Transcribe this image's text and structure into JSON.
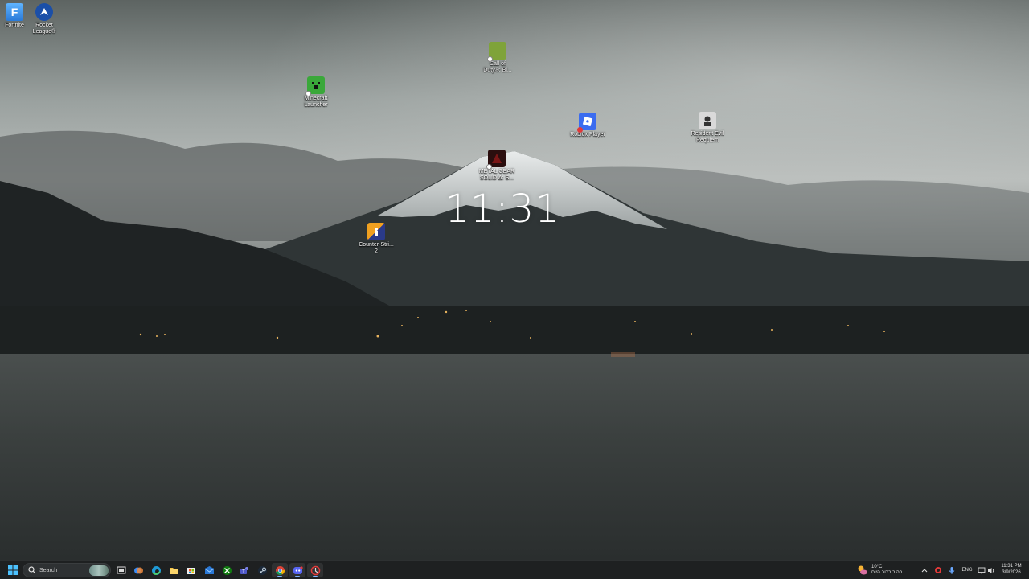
{
  "desktop": {
    "clock": "11:31",
    "icons": [
      {
        "id": "fortnite",
        "label": "Fortnite"
      },
      {
        "id": "rocket-league",
        "label": "Rocket\nLeague®"
      },
      {
        "id": "call-of-duty",
        "label": "Call of\nDuty®: Bl..."
      },
      {
        "id": "minecraft",
        "label": "Minecraft\nLauncher"
      },
      {
        "id": "roblox",
        "label": "Roblox Player"
      },
      {
        "id": "resident-evil",
        "label": "Resident Evil\nRequiem"
      },
      {
        "id": "metal-gear",
        "label": "METAL GEAR\nSOLID Δ: S..."
      },
      {
        "id": "counter-strike",
        "label": "Counter-Stri...\n2"
      }
    ]
  },
  "taskbar": {
    "search_placeholder": "Search",
    "pinned_icons": [
      "task-view-icon",
      "copilot-icon",
      "edge-icon",
      "file-explorer-icon",
      "microsoft-store-icon",
      "mail-icon",
      "xbox-icon",
      "teams-icon",
      "steam-icon",
      "chrome-icon",
      "discord-icon",
      "game-launcher-icon"
    ],
    "weather": {
      "temp": "10°C",
      "condition": "בהיר ברוב היום"
    },
    "language": "ENG",
    "time": "11:31 PM",
    "date": "3/9/2026",
    "colors": {
      "taskbar_bg": "#1e2021",
      "accent": "#7fb4ff"
    }
  }
}
